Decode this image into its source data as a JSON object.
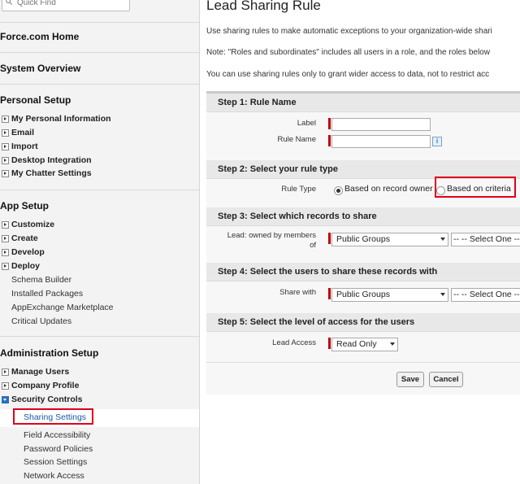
{
  "search": {
    "placeholder": "Quick Find"
  },
  "sidebar": {
    "sections": {
      "force_home": "Force.com Home",
      "system_overview": "System Overview",
      "personal_setup": "Personal Setup",
      "app_setup": "App Setup",
      "admin_setup": "Administration Setup"
    },
    "personal_items": [
      "My Personal Information",
      "Email",
      "Import",
      "Desktop Integration",
      "My Chatter Settings"
    ],
    "app_items": [
      "Customize",
      "Create",
      "Develop",
      "Deploy"
    ],
    "app_sub_items": [
      "Schema Builder",
      "Installed Packages",
      "AppExchange Marketplace",
      "Critical Updates"
    ],
    "admin_items": [
      "Manage Users",
      "Company Profile",
      "Security Controls"
    ],
    "security_sub_items": [
      "Sharing Settings",
      "Field Accessibility",
      "Password Policies",
      "Session Settings",
      "Network Access"
    ]
  },
  "main": {
    "title": "Lead Sharing Rule",
    "paragraphs": [
      "Use sharing rules to make automatic exceptions to your organization-wide shari",
      "Note: \"Roles and subordinates\" includes all users in a role, and the roles below",
      "You can use sharing rules only to grant wider access to data, not to restrict acc"
    ],
    "steps": [
      "Step 1: Rule Name",
      "Step 2: Select your rule type",
      "Step 3: Select which records to share",
      "Step 4: Select the users to share these records with",
      "Step 5: Select the level of access for the users"
    ],
    "fields": {
      "label": "Label",
      "rule_name": "Rule Name",
      "info": "i",
      "rule_type": "Rule Type",
      "owner_option": "Based on record owner",
      "criteria_option": "Based on criteria",
      "lead_owned_line1": "Lead: owned by members",
      "lead_owned_line2": "of",
      "owned_group": "Public Groups",
      "owned_select_one": "-- -- Select One --",
      "share_with": "Share with",
      "share_group": "Public Groups",
      "share_select_one": "-- -- Select One --",
      "lead_access": "Lead Access",
      "access_value": "Read Only"
    },
    "buttons": {
      "save": "Save",
      "cancel": "Cancel"
    }
  },
  "colors": {
    "highlight": "#e0001a",
    "required": "#c00000",
    "link": "#1a5aa8"
  }
}
